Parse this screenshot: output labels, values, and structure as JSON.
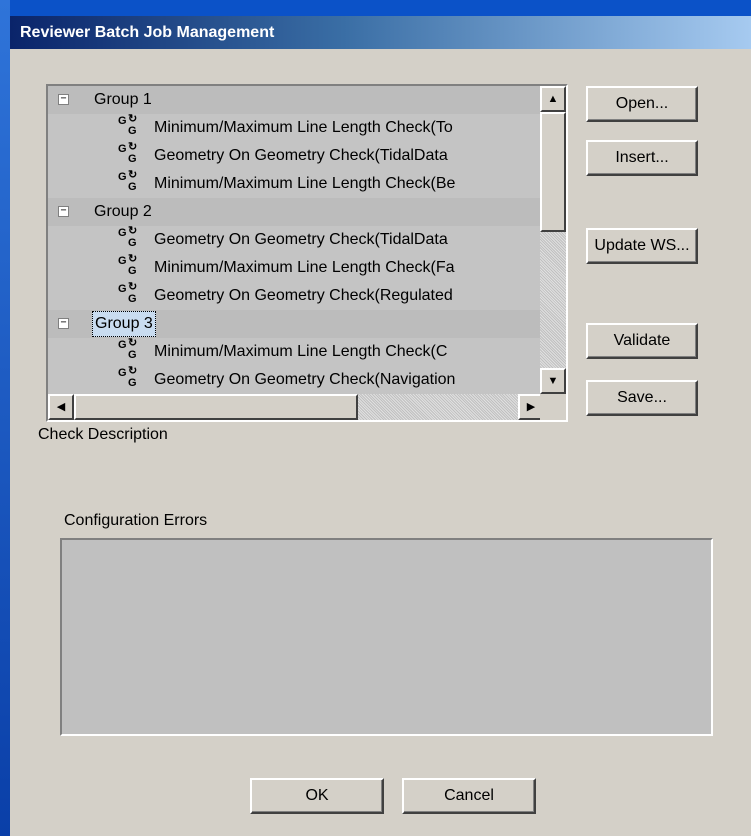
{
  "window": {
    "title": "Reviewer Batch Job Management"
  },
  "tree": {
    "rows": [
      {
        "type": "group",
        "label": "Group 1",
        "expander": "−"
      },
      {
        "type": "check",
        "label": "Minimum/Maximum Line Length Check(To"
      },
      {
        "type": "check",
        "label": "Geometry On Geometry Check(TidalData"
      },
      {
        "type": "check",
        "label": "Minimum/Maximum Line Length Check(Be"
      },
      {
        "type": "group",
        "label": "Group 2",
        "expander": "−"
      },
      {
        "type": "check",
        "label": "Geometry On Geometry Check(TidalData"
      },
      {
        "type": "check",
        "label": "Minimum/Maximum Line Length Check(Fa"
      },
      {
        "type": "check",
        "label": "Geometry On Geometry Check(Regulated"
      },
      {
        "type": "group",
        "label": "Group 3",
        "expander": "−",
        "selected": true
      },
      {
        "type": "check",
        "label": "Minimum/Maximum Line Length Check(C"
      },
      {
        "type": "check",
        "label": "Geometry On Geometry Check(Navigation"
      }
    ],
    "check_icon": "check-icon"
  },
  "buttons": {
    "open": "Open...",
    "insert": "Insert...",
    "update_ws": "Update WS...",
    "validate": "Validate",
    "save": "Save...",
    "ok": "OK",
    "cancel": "Cancel"
  },
  "labels": {
    "check_description": "Check Description",
    "configuration_errors": "Configuration Errors"
  },
  "scroll": {
    "up": "▲",
    "down": "▼",
    "left": "◀",
    "right": "▶"
  }
}
